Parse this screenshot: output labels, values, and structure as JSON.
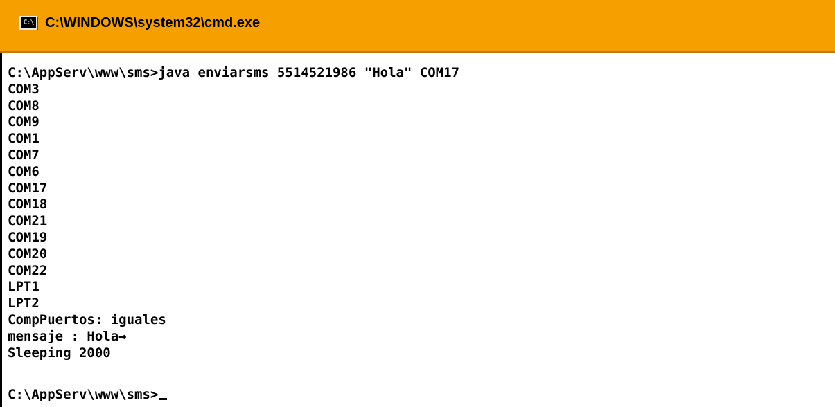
{
  "window": {
    "title": "C:\\WINDOWS\\system32\\cmd.exe",
    "icon": "cmd-icon",
    "icon_glyph": "C:\\",
    "colors": {
      "titlebar": "#f5a000",
      "console_bg": "#ffffff",
      "console_text": "#000000"
    }
  },
  "console": {
    "lines": [
      "C:\\AppServ\\www\\sms>java enviarsms 5514521986 \"Hola\" COM17",
      "COM3",
      "COM8",
      "COM9",
      "COM1",
      "COM7",
      "COM6",
      "COM17",
      "COM18",
      "COM21",
      "COM19",
      "COM20",
      "COM22",
      "LPT1",
      "LPT2",
      "CompPuertos: iguales",
      "mensaje : Hola→",
      "Sleeping 2000"
    ],
    "prompt": "C:\\AppServ\\www\\sms>"
  }
}
